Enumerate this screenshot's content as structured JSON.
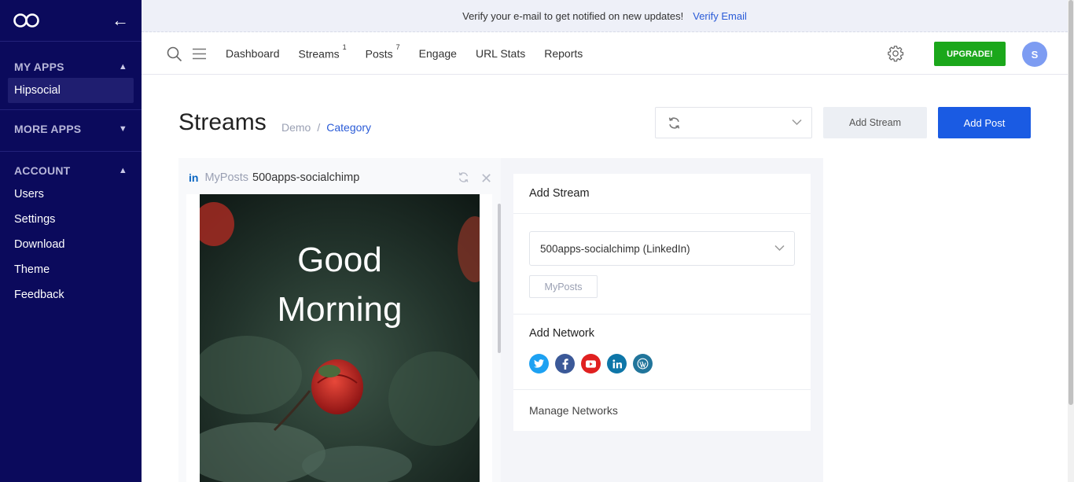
{
  "sidebar": {
    "sections": [
      {
        "title": "MY APPS",
        "items": [
          "Hipsocial"
        ]
      },
      {
        "title": "MORE APPS",
        "items": []
      },
      {
        "title": "ACCOUNT",
        "items": [
          "Users",
          "Settings",
          "Download",
          "Theme",
          "Feedback"
        ]
      }
    ]
  },
  "banner": {
    "text": "Verify your e-mail to get notified on new updates!",
    "link": "Verify Email"
  },
  "nav": {
    "links": [
      {
        "label": "Dashboard",
        "badge": ""
      },
      {
        "label": "Streams",
        "badge": "1"
      },
      {
        "label": "Posts",
        "badge": "7"
      },
      {
        "label": "Engage",
        "badge": ""
      },
      {
        "label": "URL Stats",
        "badge": ""
      },
      {
        "label": "Reports",
        "badge": ""
      }
    ],
    "upgrade_label": "UPGRADE!",
    "avatar_initial": "S"
  },
  "page": {
    "title": "Streams",
    "breadcrumb": [
      "Demo",
      "Category"
    ],
    "add_stream_label": "Add Stream",
    "add_post_label": "Add Post"
  },
  "stream": {
    "network_abbr": "in",
    "type": "MyPosts",
    "account": "500apps-socialchimp",
    "image_text_line1": "Good",
    "image_text_line2": "Morning"
  },
  "panel": {
    "title": "Add Stream",
    "select_value": "500apps-socialchimp (LinkedIn)",
    "chip": "MyPosts",
    "network_title": "Add Network",
    "networks": [
      {
        "name": "twitter-icon",
        "color": "#1da1f2"
      },
      {
        "name": "facebook-icon",
        "color": "#3b5998"
      },
      {
        "name": "youtube-icon",
        "color": "#e02020"
      },
      {
        "name": "linkedin-icon",
        "color": "#0e76a8"
      },
      {
        "name": "wordpress-icon",
        "color": "#21759b"
      }
    ],
    "manage_label": "Manage Networks"
  },
  "colors": {
    "sidebar_bg": "#0b0a5c",
    "accent": "#1a5be3",
    "upgrade": "#1ba71b"
  }
}
